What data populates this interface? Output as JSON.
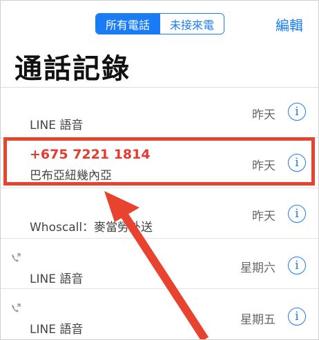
{
  "header": {
    "segments": [
      {
        "label": "所有電話",
        "active": true
      },
      {
        "label": "未接來電",
        "active": false
      }
    ],
    "edit_label": "編輯",
    "title": "通話記錄"
  },
  "calls": [
    {
      "line1": "",
      "line2": "LINE 語音",
      "date": "昨天",
      "missed": false,
      "icon": ""
    },
    {
      "line1": "+675 7221 1814",
      "line2": "巴布亞紐幾內亞",
      "date": "昨天",
      "missed": true,
      "icon": ""
    },
    {
      "line1": "",
      "line2": "Whoscall：麥當勞外送",
      "date": "昨天",
      "missed": false,
      "icon": ""
    },
    {
      "line1": "",
      "line2": "LINE 語音",
      "date": "星期六",
      "missed": false,
      "icon": "outgoing-call-icon"
    },
    {
      "line1": "",
      "line2": "LINE 語音",
      "date": "星期五",
      "missed": false,
      "icon": "outgoing-call-icon"
    }
  ],
  "colors": {
    "accent": "#1a7cf5",
    "missed": "#e53a30",
    "annotation": "#e8432f"
  },
  "info_glyph": "i"
}
